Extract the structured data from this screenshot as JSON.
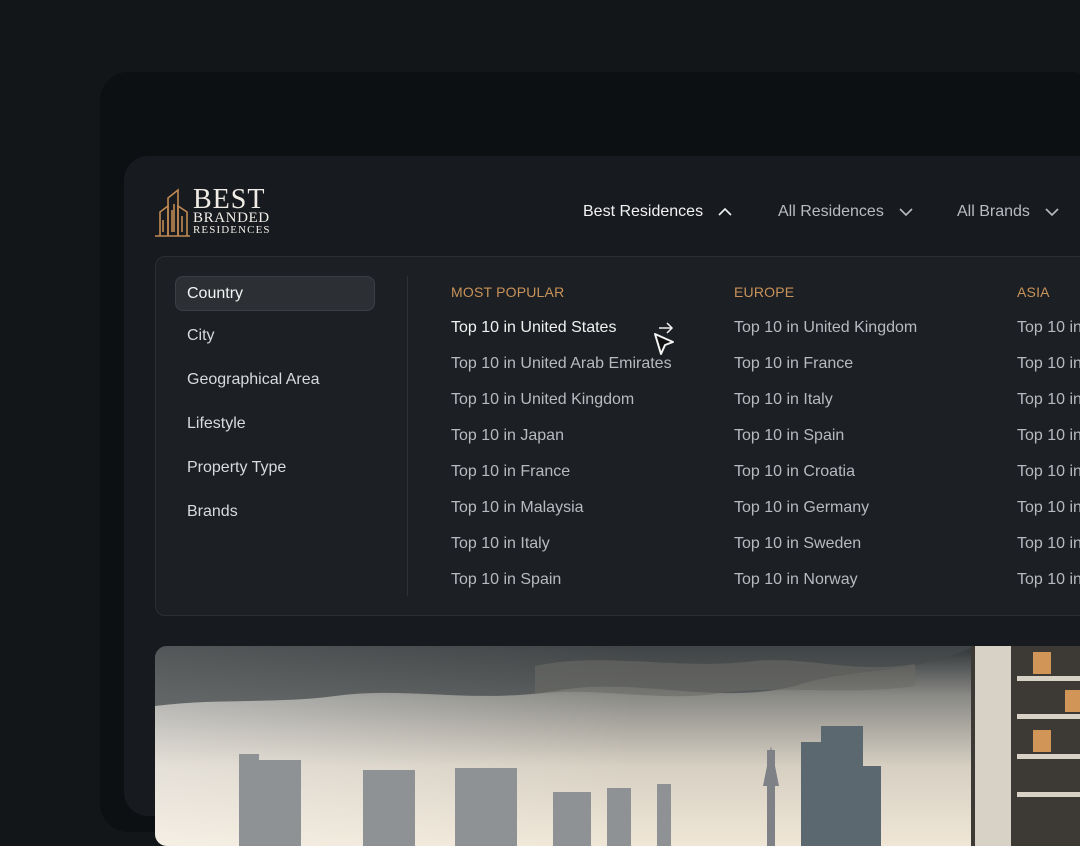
{
  "logo": {
    "line1": "BEST",
    "line2": "BRANDED",
    "line3": "RESIDENCES"
  },
  "nav": [
    {
      "label": "Best Residences"
    },
    {
      "label": "All Residences"
    },
    {
      "label": "All Brands"
    }
  ],
  "categories": [
    {
      "label": "Country"
    },
    {
      "label": "City"
    },
    {
      "label": "Geographical Area"
    },
    {
      "label": "Lifestyle"
    },
    {
      "label": "Property Type"
    },
    {
      "label": "Brands"
    }
  ],
  "columns": [
    {
      "heading": "MOST POPULAR",
      "links": [
        "Top 10 in United States",
        "Top 10 in United Arab Emirates",
        "Top 10 in United Kingdom",
        "Top 10 in Japan",
        "Top 10 in France",
        "Top 10 in Malaysia",
        "Top 10 in Italy",
        "Top 10 in Spain"
      ]
    },
    {
      "heading": "EUROPE",
      "links": [
        "Top 10 in United Kingdom",
        "Top 10 in France",
        "Top 10 in Italy",
        "Top 10 in Spain",
        "Top 10 in Croatia",
        "Top 10 in Germany",
        "Top 10 in Sweden",
        "Top 10 in Norway"
      ]
    },
    {
      "heading": "ASIA",
      "links": [
        "Top 10 in",
        "Top 10 in",
        "Top 10 in",
        "Top 10 in",
        "Top 10 in",
        "Top 10 in",
        "Top 10 in",
        "Top 10 in"
      ]
    }
  ],
  "colors": {
    "accent": "#c8935a",
    "background": "#121619",
    "panel": "#1c1f23"
  }
}
